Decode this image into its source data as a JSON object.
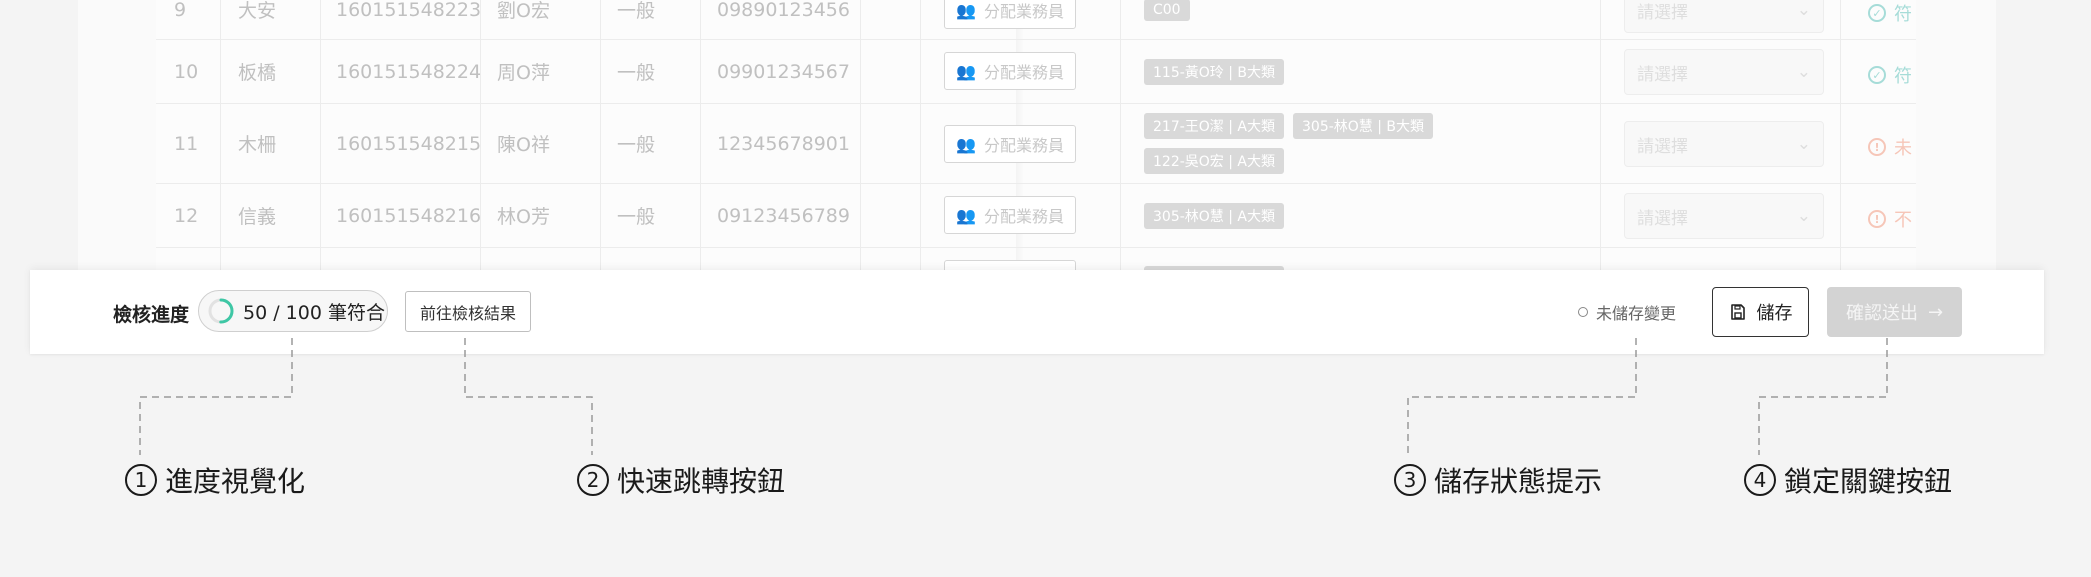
{
  "table": {
    "rows": [
      {
        "no": "9",
        "district": "大安",
        "id": "160151548223",
        "name": "劉O宏",
        "type": "一般",
        "phone": "09890123456",
        "assign": "分配業務員",
        "tags": [
          "C00"
        ],
        "select": "請選擇",
        "status": "符",
        "status_kind": "ok"
      },
      {
        "no": "10",
        "district": "板橋",
        "id": "160151548224",
        "name": "周O萍",
        "type": "一般",
        "phone": "09901234567",
        "assign": "分配業務員",
        "tags": [
          "115-黃O玲 | B大類"
        ],
        "select": "請選擇",
        "status": "符",
        "status_kind": "ok"
      },
      {
        "no": "11",
        "district": "木柵",
        "id": "160151548215",
        "name": "陳O祥",
        "type": "一般",
        "phone": "12345678901",
        "assign": "分配業務員",
        "tags": [
          "217-王O潔 | A大類",
          "305-林O慧 | B大類",
          "122-吳O宏 | A大類"
        ],
        "select": "請選擇",
        "status": "未",
        "status_kind": "warn"
      },
      {
        "no": "12",
        "district": "信義",
        "id": "160151548216",
        "name": "林O芳",
        "type": "一般",
        "phone": "09123456789",
        "assign": "分配業務員",
        "tags": [
          "305-林O慧 | A大類"
        ],
        "select": "請選擇",
        "status": "不",
        "status_kind": "warn"
      }
    ]
  },
  "bar": {
    "progress_label": "檢核進度",
    "progress_text": "50 / 100  筆符合",
    "progress_fraction": 0.5,
    "goto_label": "前往檢核結果",
    "save_status": "未儲存變更",
    "save_label": "儲存",
    "submit_label": "確認送出"
  },
  "callouts": [
    {
      "num": "1",
      "text": "進度視覺化"
    },
    {
      "num": "2",
      "text": "快速跳轉按鈕"
    },
    {
      "num": "3",
      "text": "儲存狀態提示"
    },
    {
      "num": "4",
      "text": "鎖定關鍵按鈕"
    }
  ],
  "colors": {
    "progress_ring": "#3ec7a5",
    "status_ok": "#a6dcd8",
    "status_warn": "#f6c6b8",
    "submit_disabled_bg": "#d3d3d3"
  }
}
